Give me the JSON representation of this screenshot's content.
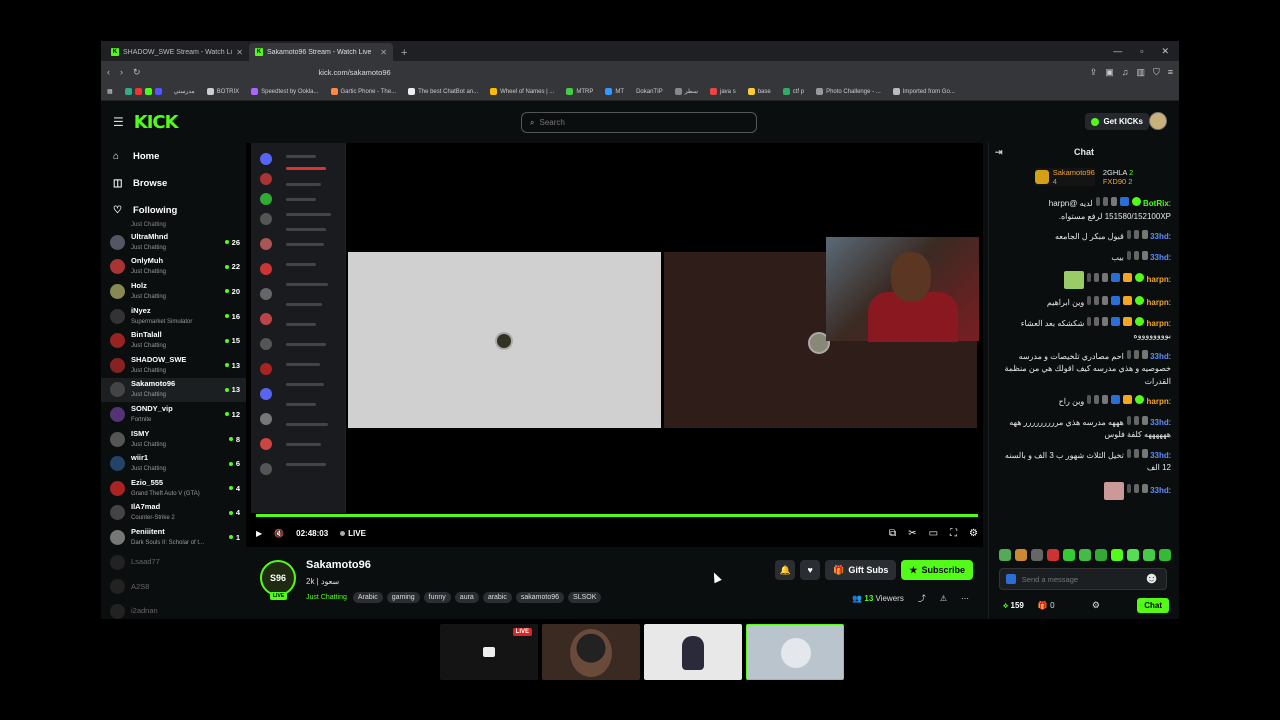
{
  "browser": {
    "tabs": [
      {
        "title": "SHADOW_SWE Stream - Watch Live"
      },
      {
        "title": "Sakamoto96 Stream - Watch Live"
      }
    ],
    "url": "kick.com/sakamoto96",
    "bookmarks": [
      "مدرستي",
      "BOTRIX",
      "Speedtest by Ookla...",
      "Gartic Phone - The...",
      "The best ChatBot an...",
      "Wheel of Names | ...",
      "MTRP",
      "MT",
      "DokanTIP",
      "سطر",
      "java s",
      "base",
      "ctf p",
      "Photo Challenge - ...",
      "Imported from Go..."
    ]
  },
  "topnav": {
    "logo": "KICK",
    "search_placeholder": "Search",
    "get_kicks": "Get KICKs"
  },
  "sidebar": {
    "main": [
      {
        "label": "Home",
        "icon": "home-icon"
      },
      {
        "label": "Browse",
        "icon": "compass-icon"
      },
      {
        "label": "Following",
        "icon": "heart-icon"
      }
    ],
    "top_sub": "Just Chatting",
    "channels": [
      {
        "name": "UltraMhnd",
        "category": "Just Chatting",
        "viewers": "26",
        "color": "#556"
      },
      {
        "name": "OnlyMuh",
        "category": "Just Chatting",
        "viewers": "22",
        "color": "#a33"
      },
      {
        "name": "Holz",
        "category": "Just Chatting",
        "viewers": "20",
        "color": "#885"
      },
      {
        "name": "iNyez",
        "category": "Supermarket Simulator",
        "viewers": "16",
        "color": "#333"
      },
      {
        "name": "BinTalall",
        "category": "Just Chatting",
        "viewers": "15",
        "color": "#922"
      },
      {
        "name": "SHADOW_SWE",
        "category": "Just Chatting",
        "viewers": "13",
        "color": "#822"
      },
      {
        "name": "Sakamoto96",
        "category": "Just Chatting",
        "viewers": "13",
        "color": "#444"
      },
      {
        "name": "SONDY_vip",
        "category": "Fortnite",
        "viewers": "12",
        "color": "#537"
      },
      {
        "name": "ISMY",
        "category": "Just Chatting",
        "viewers": "8",
        "color": "#555"
      },
      {
        "name": "wiir1",
        "category": "Just Chatting",
        "viewers": "6",
        "color": "#246"
      },
      {
        "name": "Ezio_555",
        "category": "Grand Theft Auto V (GTA)",
        "viewers": "4",
        "color": "#a22"
      },
      {
        "name": "IlA7mad",
        "category": "Counter-Strike 2",
        "viewers": "4",
        "color": "#444"
      },
      {
        "name": "Peniiitent",
        "category": "Dark Souls II: Scholar of t...",
        "viewers": "1",
        "color": "#777"
      }
    ],
    "offline": [
      "Lsaad77",
      "A2S8",
      "i2adnan"
    ]
  },
  "player": {
    "time": "02:48:03",
    "live": "LIVE",
    "progress": 1.0
  },
  "channel": {
    "avatar_text": "S96",
    "live_badge": "LIVE",
    "name": "Sakamoto96",
    "subtitle": "2k | سعود",
    "category": "Just Chatting",
    "tags": [
      "Arabic",
      "gaming",
      "funny",
      "aura",
      "arabic",
      "sakamoto96",
      "SLSOK"
    ],
    "gift_subs": "Gift Subs",
    "subscribe": "Subscribe",
    "viewers_count": "13",
    "viewers_label": "Viewers"
  },
  "chat": {
    "title": "Chat",
    "leaderboard": {
      "top": "Sakamoto96",
      "top_sub": "4",
      "second": "2GHLA",
      "second_count": "2",
      "third": "FXD90",
      "third_count": "2"
    },
    "messages": [
      {
        "user": "BotRix",
        "user_color": "#53fc18",
        "text": "لديه @harpn",
        "text2": "151580/152100XP لرفع مستواه."
      },
      {
        "user": "33hd",
        "user_color": "#5b8cff",
        "text": "قبول مبكر ل الجامعه"
      },
      {
        "user": "33hd",
        "user_color": "#5b8cff",
        "text": "بيب"
      },
      {
        "user": "harpn",
        "user_color": "#f5a524",
        "text": ""
      },
      {
        "user": "harpn",
        "user_color": "#f5a524",
        "text": "وين ابراهيم"
      },
      {
        "user": "harpn",
        "user_color": "#f5a524",
        "text": "شكشكه بعد العشاء بووووووووه"
      },
      {
        "user": "33hd",
        "user_color": "#5b8cff",
        "text": "احم مصادري تلخيصات و مدرسه خصوصيه و هذي مدرسه كيف اقولك هي من منظمة القدرات"
      },
      {
        "user": "harpn",
        "user_color": "#f5a524",
        "text": "وين راح"
      },
      {
        "user": "33hd",
        "user_color": "#5b8cff",
        "text": "هههه مدرسه هذي مررررررررر ههه ههههههه كلفة فلوس"
      },
      {
        "user": "33hd",
        "user_color": "#5b8cff",
        "text": "تخيل الثلاث شهور ب 3 الف و بالسنه 12 الف"
      },
      {
        "user": "33hd",
        "user_color": "#5b8cff",
        "text": ""
      }
    ],
    "input_placeholder": "Send a message",
    "points": "159",
    "gifts": "0",
    "send": "Chat"
  },
  "meet": {
    "live_label": "LIVE"
  }
}
